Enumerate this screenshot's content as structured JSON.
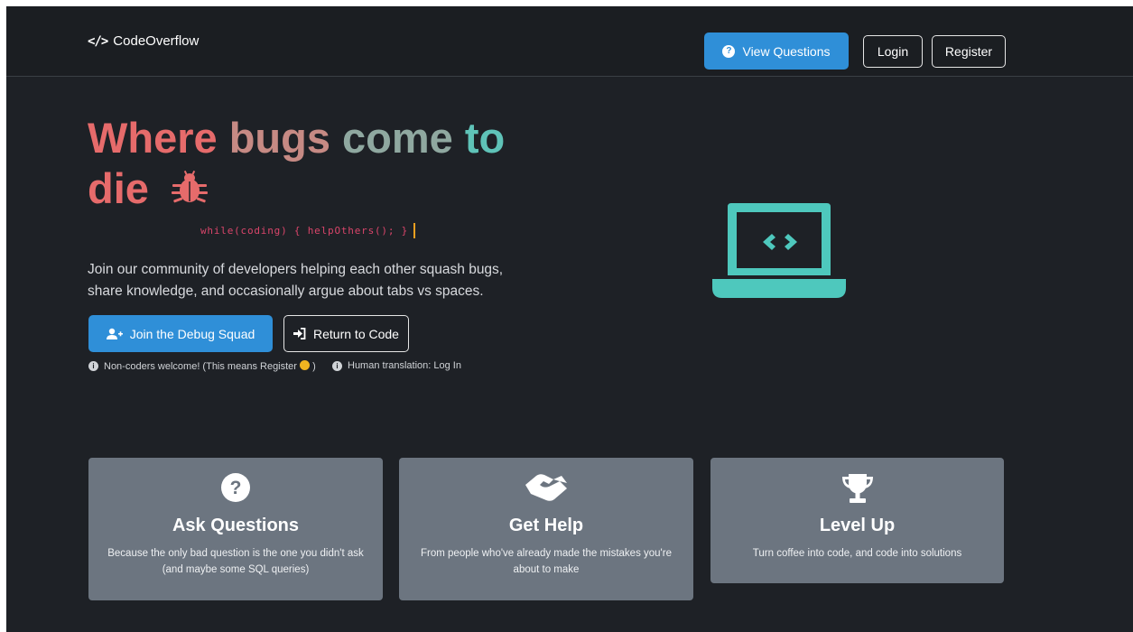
{
  "navbar": {
    "brand_icon": "</>",
    "brand_name": "CodeOverflow",
    "view_questions_label": "View Questions",
    "login_label": "Login",
    "register_label": "Register"
  },
  "hero": {
    "title_words": [
      "Where",
      "bugs",
      "come",
      "to",
      "die"
    ],
    "code_snippet": "while(coding) { helpOthers(); }",
    "description": "Join our community of developers helping each other squash bugs, share knowledge, and occasionally argue about tabs vs spaces.",
    "join_label": "Join the Debug Squad",
    "return_label": "Return to Code",
    "hint_register": "Non-coders welcome! (This means Register",
    "hint_register_end": ")",
    "hint_login": "Human translation: Log In"
  },
  "features": [
    {
      "title": "Ask Questions",
      "text": "Because the only bad question is the one you didn't ask (and maybe some SQL queries)",
      "icon": "question-circle-icon"
    },
    {
      "title": "Get Help",
      "text": "From people who've already made the mistakes you're about to make",
      "icon": "handshake-icon"
    },
    {
      "title": "Level Up",
      "text": "Turn coffee into code, and code into solutions",
      "icon": "trophy-icon"
    }
  ],
  "colors": {
    "background": "#1e2126",
    "primary": "#2f8fd8",
    "accent_red": "#e66b6b",
    "accent_teal": "#5fc3b8",
    "card": "#6c7580"
  }
}
